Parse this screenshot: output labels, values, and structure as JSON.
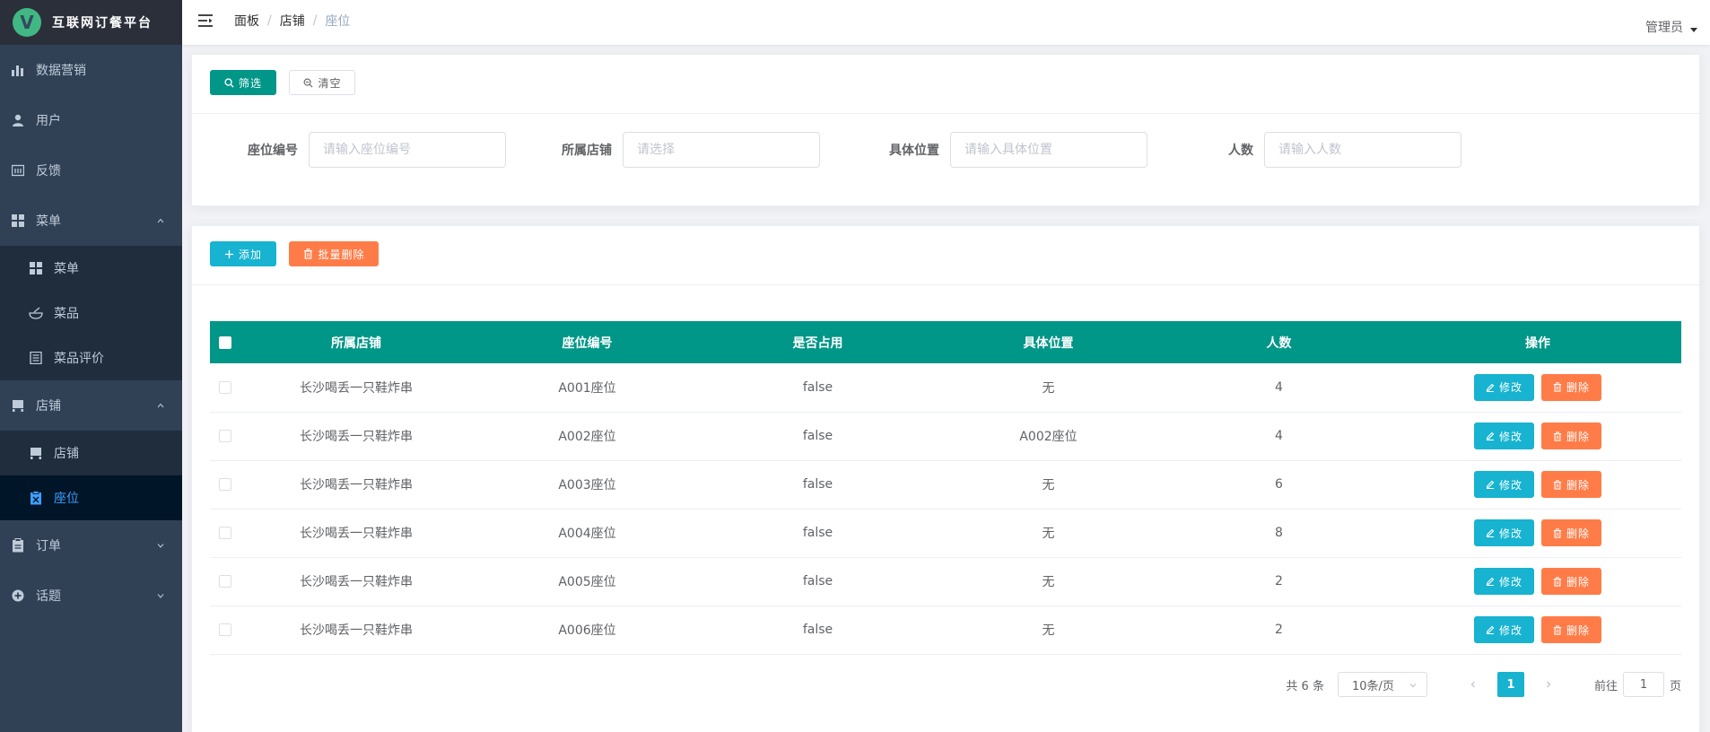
{
  "app": {
    "logo_letter": "V",
    "title": "互联网订餐平台"
  },
  "sidebar": {
    "items": [
      {
        "label": "数据营销",
        "icon": "bar-chart-icon"
      },
      {
        "label": "用户",
        "icon": "user-icon"
      },
      {
        "label": "反馈",
        "icon": "feedback-icon"
      },
      {
        "label": "菜单",
        "icon": "grid-icon",
        "expanded": true,
        "children": [
          {
            "label": "菜单",
            "icon": "grid-icon"
          },
          {
            "label": "菜品",
            "icon": "dish-icon"
          },
          {
            "label": "菜品评价",
            "icon": "document-icon"
          }
        ]
      },
      {
        "label": "店铺",
        "icon": "store-icon",
        "expanded": true,
        "children": [
          {
            "label": "店铺",
            "icon": "store-icon"
          },
          {
            "label": "座位",
            "icon": "seat-icon",
            "active": true
          }
        ]
      },
      {
        "label": "订单",
        "icon": "clipboard-icon",
        "expanded": false
      },
      {
        "label": "话题",
        "icon": "topic-icon",
        "expanded": false
      }
    ]
  },
  "header": {
    "breadcrumb": [
      "面板",
      "店铺",
      "座位"
    ],
    "user": "管理员"
  },
  "filter": {
    "search_label": "筛选",
    "clear_label": "清空",
    "fields": [
      {
        "label": "座位编号",
        "placeholder": "请输入座位编号"
      },
      {
        "label": "所属店铺",
        "placeholder": "请选择"
      },
      {
        "label": "具体位置",
        "placeholder": "请输入具体位置"
      },
      {
        "label": "人数",
        "placeholder": "请输入人数"
      }
    ]
  },
  "toolbar": {
    "add_label": "添加",
    "batch_delete_label": "批量删除"
  },
  "table": {
    "columns": [
      "所属店铺",
      "座位编号",
      "是否占用",
      "具体位置",
      "人数",
      "操作"
    ],
    "edit_label": "修改",
    "delete_label": "删除",
    "rows": [
      {
        "store": "长沙喝丢一只鞋炸串",
        "seat_no": "A001座位",
        "occupied": "false",
        "location": "无",
        "people": "4"
      },
      {
        "store": "长沙喝丢一只鞋炸串",
        "seat_no": "A002座位",
        "occupied": "false",
        "location": "A002座位",
        "people": "4"
      },
      {
        "store": "长沙喝丢一只鞋炸串",
        "seat_no": "A003座位",
        "occupied": "false",
        "location": "无",
        "people": "6"
      },
      {
        "store": "长沙喝丢一只鞋炸串",
        "seat_no": "A004座位",
        "occupied": "false",
        "location": "无",
        "people": "8"
      },
      {
        "store": "长沙喝丢一只鞋炸串",
        "seat_no": "A005座位",
        "occupied": "false",
        "location": "无",
        "people": "2"
      },
      {
        "store": "长沙喝丢一只鞋炸串",
        "seat_no": "A006座位",
        "occupied": "false",
        "location": "无",
        "people": "2"
      }
    ]
  },
  "pagination": {
    "total": "共 6 条",
    "page_size": "10条/页",
    "current_page": "1",
    "goto_prefix": "前往",
    "goto_value": "1",
    "goto_suffix": "页"
  },
  "colors": {
    "sidebar_bg": "#304156",
    "primary": "#009688",
    "info": "#17b3d0",
    "danger": "#ff7c48",
    "active": "#409eff"
  }
}
